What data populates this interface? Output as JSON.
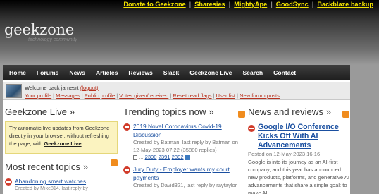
{
  "toplinks": [
    "Donate to Geekzone",
    "Sharesies",
    "MightyApe",
    "GoodSync",
    "Backblaze backup"
  ],
  "logo": {
    "name": "geekzone",
    "tagline": "technology community"
  },
  "nav": [
    "Home",
    "Forums",
    "News",
    "Articles",
    "Reviews",
    "Slack",
    "Geekzone Live",
    "Search",
    "Contact"
  ],
  "userbar": {
    "welcome": "Welcome back",
    "username": "jamesrt",
    "logout": "(logout)",
    "links": [
      "Your profile",
      "Messages",
      "Public profile",
      "Votes given/received",
      "Reset read flags",
      "User list",
      "New forum posts"
    ]
  },
  "live": {
    "title": "Geekzone Live »",
    "text": "Try automatic live updates from Geekzone directly in your browser, without refreshing the page, with",
    "link": "Geekzone Live",
    "end": "."
  },
  "recent": {
    "title": "Most recent topics »",
    "items": [
      {
        "title": "Abandoning smart watches",
        "meta": "Created by Mike814, last reply by"
      }
    ]
  },
  "trending": {
    "title": "Trending topics now »",
    "items": [
      {
        "title": "2019 Novel Coronavirus Covid-19 Discussion",
        "meta1": "Created by Batman, last reply by Batman on",
        "meta2": "12-May-2023 07:22 (35880 replies)",
        "pages_prefix": "...",
        "pages": [
          "2390",
          "2391",
          "2392"
        ]
      },
      {
        "title": "Jury Duty - Employer wants my court payments",
        "meta1": "Created by David321, last reply by raytaylor"
      }
    ]
  },
  "news": {
    "title": "News and reviews »",
    "item": {
      "title": "Google I/O Conference Kicks Off With AI Advancements",
      "posted": "Posted on 12-May-2023 16:16",
      "body": "Google is into its journey as an AI-first company, and this year has announced new products, platforms, and generative AI advancements that share a single goal: to make AI"
    }
  }
}
